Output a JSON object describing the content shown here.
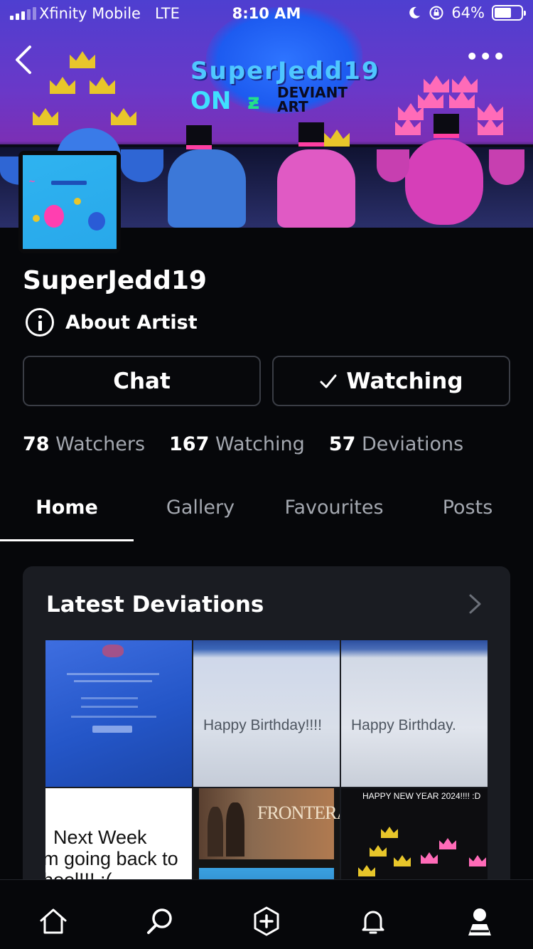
{
  "status_bar": {
    "carrier": "Xfinity Mobile",
    "network": "LTE",
    "time": "8:10 AM",
    "battery": "64%",
    "battery_level": 0.64
  },
  "banner": {
    "title": "SuperJedd19",
    "on_text": "ON",
    "deviantart_line1": "DEVIANT",
    "deviantart_line2": "ART"
  },
  "profile": {
    "username": "SuperJedd19",
    "about_label": "About Artist",
    "chat_label": "Chat",
    "watching_label": "Watching",
    "stats": [
      {
        "num": "78",
        "label": "Watchers"
      },
      {
        "num": "167",
        "label": "Watching"
      },
      {
        "num": "57",
        "label": "Deviations"
      }
    ]
  },
  "tabs": [
    {
      "label": "Home",
      "active": true
    },
    {
      "label": "Gallery",
      "active": false
    },
    {
      "label": "Favourites",
      "active": false
    },
    {
      "label": "Posts",
      "active": false
    }
  ],
  "latest": {
    "title": "Latest Deviations",
    "thumbnails": [
      {
        "name": "blue-notice-photo",
        "text": ""
      },
      {
        "name": "happy-birthday-screen-1",
        "text": "Happy Birthday!!!!"
      },
      {
        "name": "happy-birthday-screen-2",
        "text": "Happy Birthday."
      },
      {
        "name": "next-week-note",
        "text": "  Next Week\nm going back to\nhool!!! :("
      },
      {
        "name": "frontera-poster",
        "text": "FRONTERA"
      },
      {
        "name": "happy-new-year",
        "text": "HAPPY NEW YEAR 2024!!!! :D"
      }
    ]
  },
  "bottom_nav": [
    "home-icon",
    "search-icon",
    "create-icon",
    "notifications-icon",
    "profile-icon"
  ],
  "colors": {
    "background": "#06070a",
    "card": "#1a1c22",
    "muted_text": "#a4a8b0",
    "button_border": "#3a3d45"
  }
}
